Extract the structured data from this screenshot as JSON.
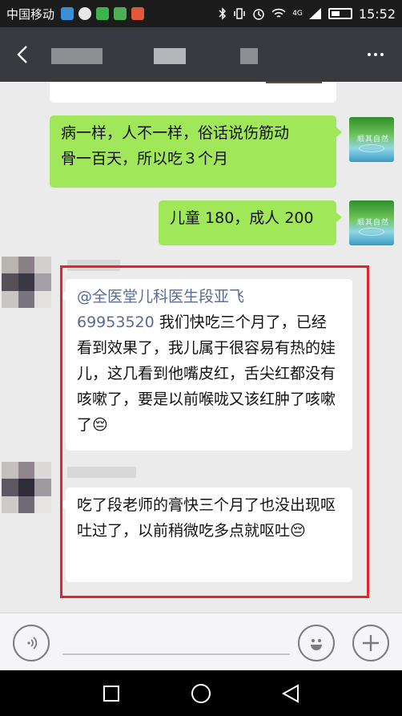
{
  "status_bar": {
    "carrier": "中国移动",
    "network": "4G",
    "time": "15:52",
    "notification_icons": [
      {
        "name": "notification-app-icon-1",
        "color": "#3b8fd9"
      },
      {
        "name": "notification-app-icon-2",
        "color": "#e7e7e7"
      },
      {
        "name": "notification-app-icon-3",
        "color": "#3cb44b"
      },
      {
        "name": "notification-app-icon-4",
        "color": "#4caf50"
      },
      {
        "name": "notification-app-icon-5",
        "color": "#e05a3a"
      }
    ],
    "status_icons": [
      "bluetooth-icon",
      "vibrate-icon",
      "alarm-icon",
      "wifi-icon",
      "signal-icon",
      "battery-icon"
    ]
  },
  "title_bar": {
    "back_icon": "chevron-left-icon",
    "more_icon": "more-dots-icon"
  },
  "messages": [
    {
      "side": "out",
      "text": "病一样，人不一样，俗话说伤筋动\n骨一百天，所以吃３个月"
    },
    {
      "side": "out",
      "text": "儿童 180，成人 200"
    },
    {
      "side": "in",
      "mention": "@全医堂儿科医生段亚飞\n69953520",
      "text": " 我们快吃三个月了，已经看到效果了，我儿属于很容易有热的娃儿，这几看到他嘴皮红，舌尖红都没有咳嗽了，要是以前喉咙又该红肿了咳嗽了",
      "emoji": "😔"
    },
    {
      "side": "in",
      "text": "吃了段老师的膏快三个月了也没出现呕吐过了，以前稍微吃多点就呕吐",
      "emoji": "😔"
    }
  ],
  "self_avatar_text": "顺其自然",
  "input_bar": {
    "voice_icon": "voice-icon",
    "emoji_icon": "emoji-smile-icon",
    "plus_icon": "plus-icon",
    "value": ""
  },
  "colors": {
    "outgoing_bubble": "#a0e75a",
    "incoming_bubble": "#ffffff",
    "title_bar": "#393a3f",
    "highlight": "#e4242c",
    "mention_link": "#576b95"
  }
}
